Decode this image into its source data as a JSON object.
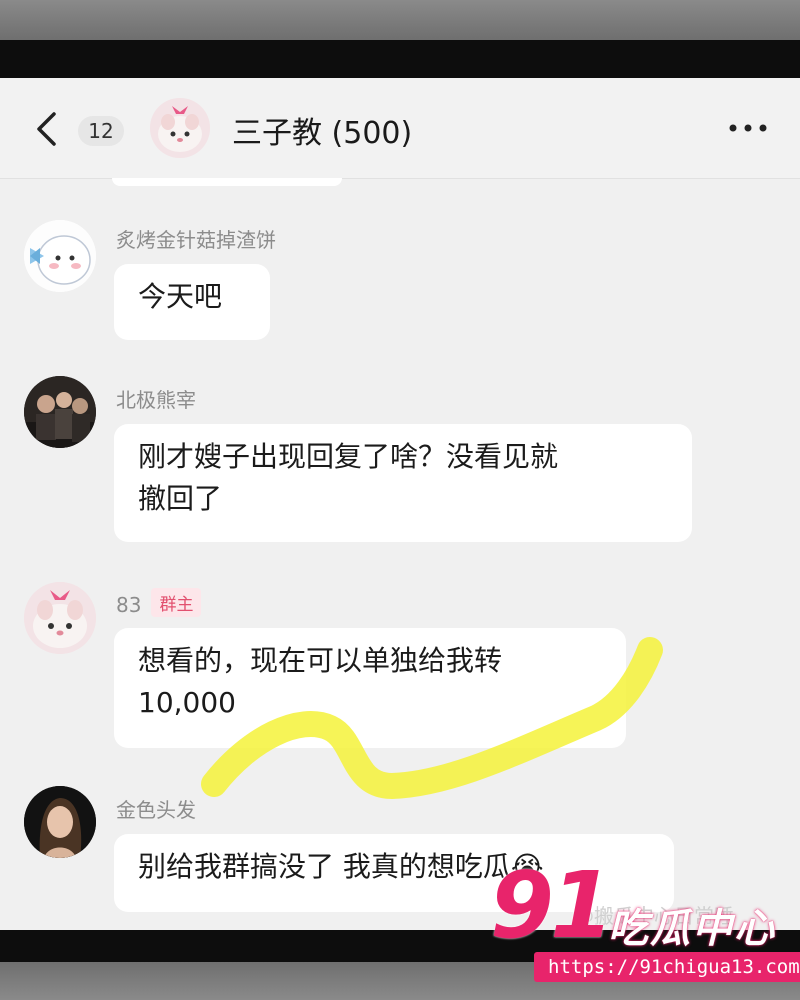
{
  "header": {
    "unread_count": "12",
    "title": "三子教 (500)"
  },
  "messages": [
    {
      "sender": "炙烤金针菇掉渣饼",
      "text": [
        "今天吧"
      ]
    },
    {
      "sender": "北极熊宰",
      "text": [
        "刚才嫂子出现回复了啥？没看见就",
        "撤回了"
      ]
    },
    {
      "sender": "83",
      "role": "群主",
      "text": [
        "想看的，现在可以单独给我转",
        "10,000"
      ]
    },
    {
      "sender": "金色头发",
      "text": [
        "别给我群搞没了 我真的想吃瓜😭"
      ]
    }
  ],
  "watermark": {
    "number": "91",
    "title": "吃瓜中心",
    "url": "https://91chigua13.com",
    "faint_text": "@搬瓜中心日常睡"
  },
  "colors": {
    "highlight": "#f4f23a",
    "brand": "#e8246b",
    "bubble": "#ffffff",
    "chat_bg": "#f0f0f0"
  },
  "icons": {
    "back": "chevron-left-icon",
    "more": "more-dots-icon"
  }
}
